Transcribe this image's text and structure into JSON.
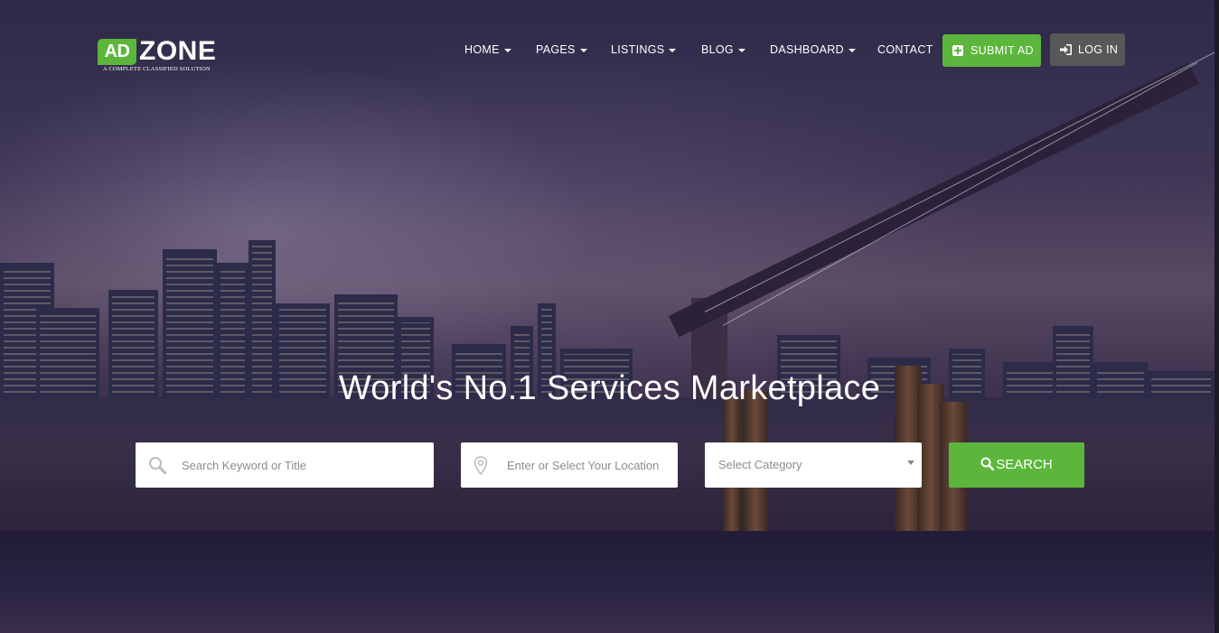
{
  "brand": {
    "logo_ad": "AD",
    "logo_zone": "ZONE",
    "tagline": "A COMPLETE CLASSIFIED SOLUTION"
  },
  "nav": {
    "items": [
      {
        "label": "HOME",
        "has_dropdown": true
      },
      {
        "label": "PAGES",
        "has_dropdown": true
      },
      {
        "label": "LISTINGS",
        "has_dropdown": true
      },
      {
        "label": "BLOG",
        "has_dropdown": true
      },
      {
        "label": "DASHBOARD",
        "has_dropdown": true
      },
      {
        "label": "CONTACT",
        "has_dropdown": false
      }
    ],
    "submit_ad_label": "SUBMIT AD",
    "login_label": "LOG IN"
  },
  "hero": {
    "headline": "World's No.1 Services Marketplace"
  },
  "search": {
    "keyword_placeholder": "Search Keyword or Title",
    "location_placeholder": "Enter or Select Your Location",
    "category_selected": "Select Category",
    "button_label": "SEARCH"
  },
  "colors": {
    "accent_green": "#5cb63c",
    "login_gray": "#595757",
    "text_white": "#ffffff"
  },
  "icons": {
    "submit": "plus-square-icon",
    "login": "sign-in-icon",
    "keyword": "search-icon",
    "location": "map-pin-icon",
    "search_button": "search-icon"
  }
}
